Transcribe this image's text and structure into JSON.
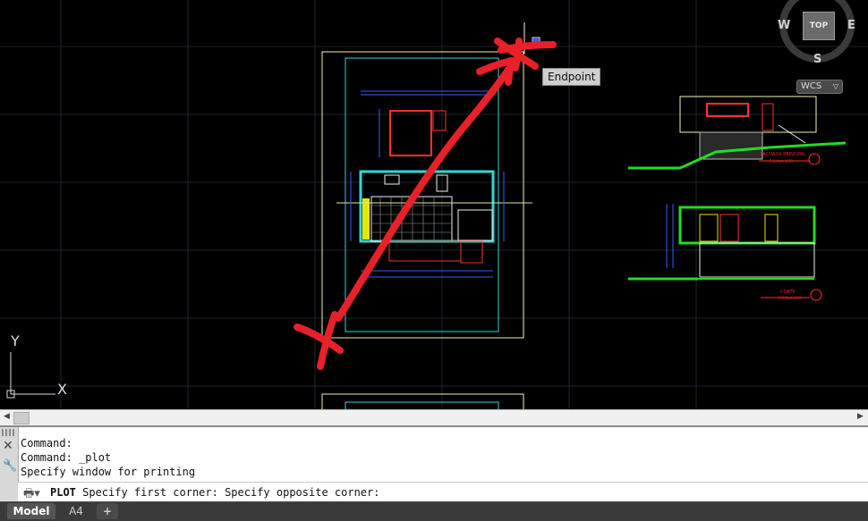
{
  "viewport": {
    "tooltip": "Endpoint",
    "viewcube": {
      "top_label": "TOP",
      "west": "W",
      "east": "E",
      "south": "S"
    },
    "wcs_label": "WCS",
    "ucs": {
      "y_label": "Y",
      "x_label": "X"
    },
    "drawing_labels": {
      "elevation_title": "FACHADA PRINCIPAL",
      "elevation_scale": "ESCALA 1/50",
      "section_title": "CORTE",
      "section_scale": "ESCALA 1/50"
    },
    "annotation_color": "#e8202a"
  },
  "command_panel": {
    "history": [
      "Command:",
      "Command: _plot",
      "Specify window for printing"
    ],
    "prompt_command": "PLOT",
    "prompt_text": " Specify first corner: Specify opposite corner:"
  },
  "tabs": {
    "model": "Model",
    "layout": "A4",
    "add": "+"
  }
}
